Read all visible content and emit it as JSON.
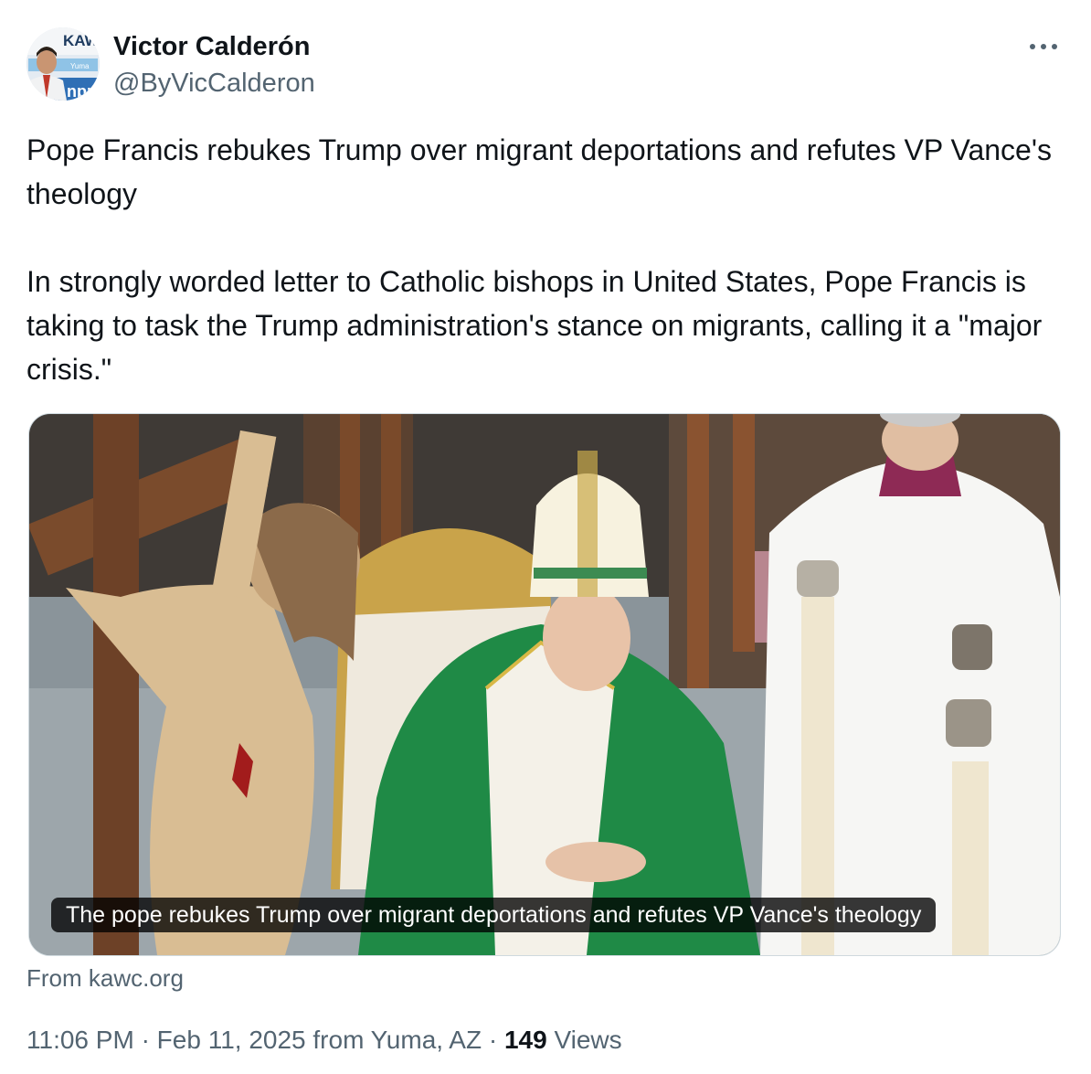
{
  "author": {
    "name": "Victor Calderón",
    "handle": "@ByVicCalderon",
    "avatar_text": [
      "KAW",
      "Yuma",
      "npr"
    ]
  },
  "tweet": {
    "paragraphs": [
      "Pope Francis rebukes Trump over migrant deportations and refutes VP Vance's theology",
      "In strongly worded letter to Catholic bishops in United States, Pope Francis is taking to task the Trump administration's stance on migrants, calling it a \"major crisis.\""
    ]
  },
  "card": {
    "caption": "The pope rebukes Trump over migrant deportations and refutes VP Vance's theology",
    "source": "From kawc.org"
  },
  "meta": {
    "time": "11:06 PM",
    "date": "Feb 11, 2025",
    "location": "from Yuma, AZ",
    "separator": "·",
    "views_count": "149",
    "views_label": "Views"
  },
  "colors": {
    "text_primary": "#0f1419",
    "text_secondary": "#536471",
    "border": "#cfd9de"
  },
  "icons": {
    "more": "ellipsis-icon"
  }
}
